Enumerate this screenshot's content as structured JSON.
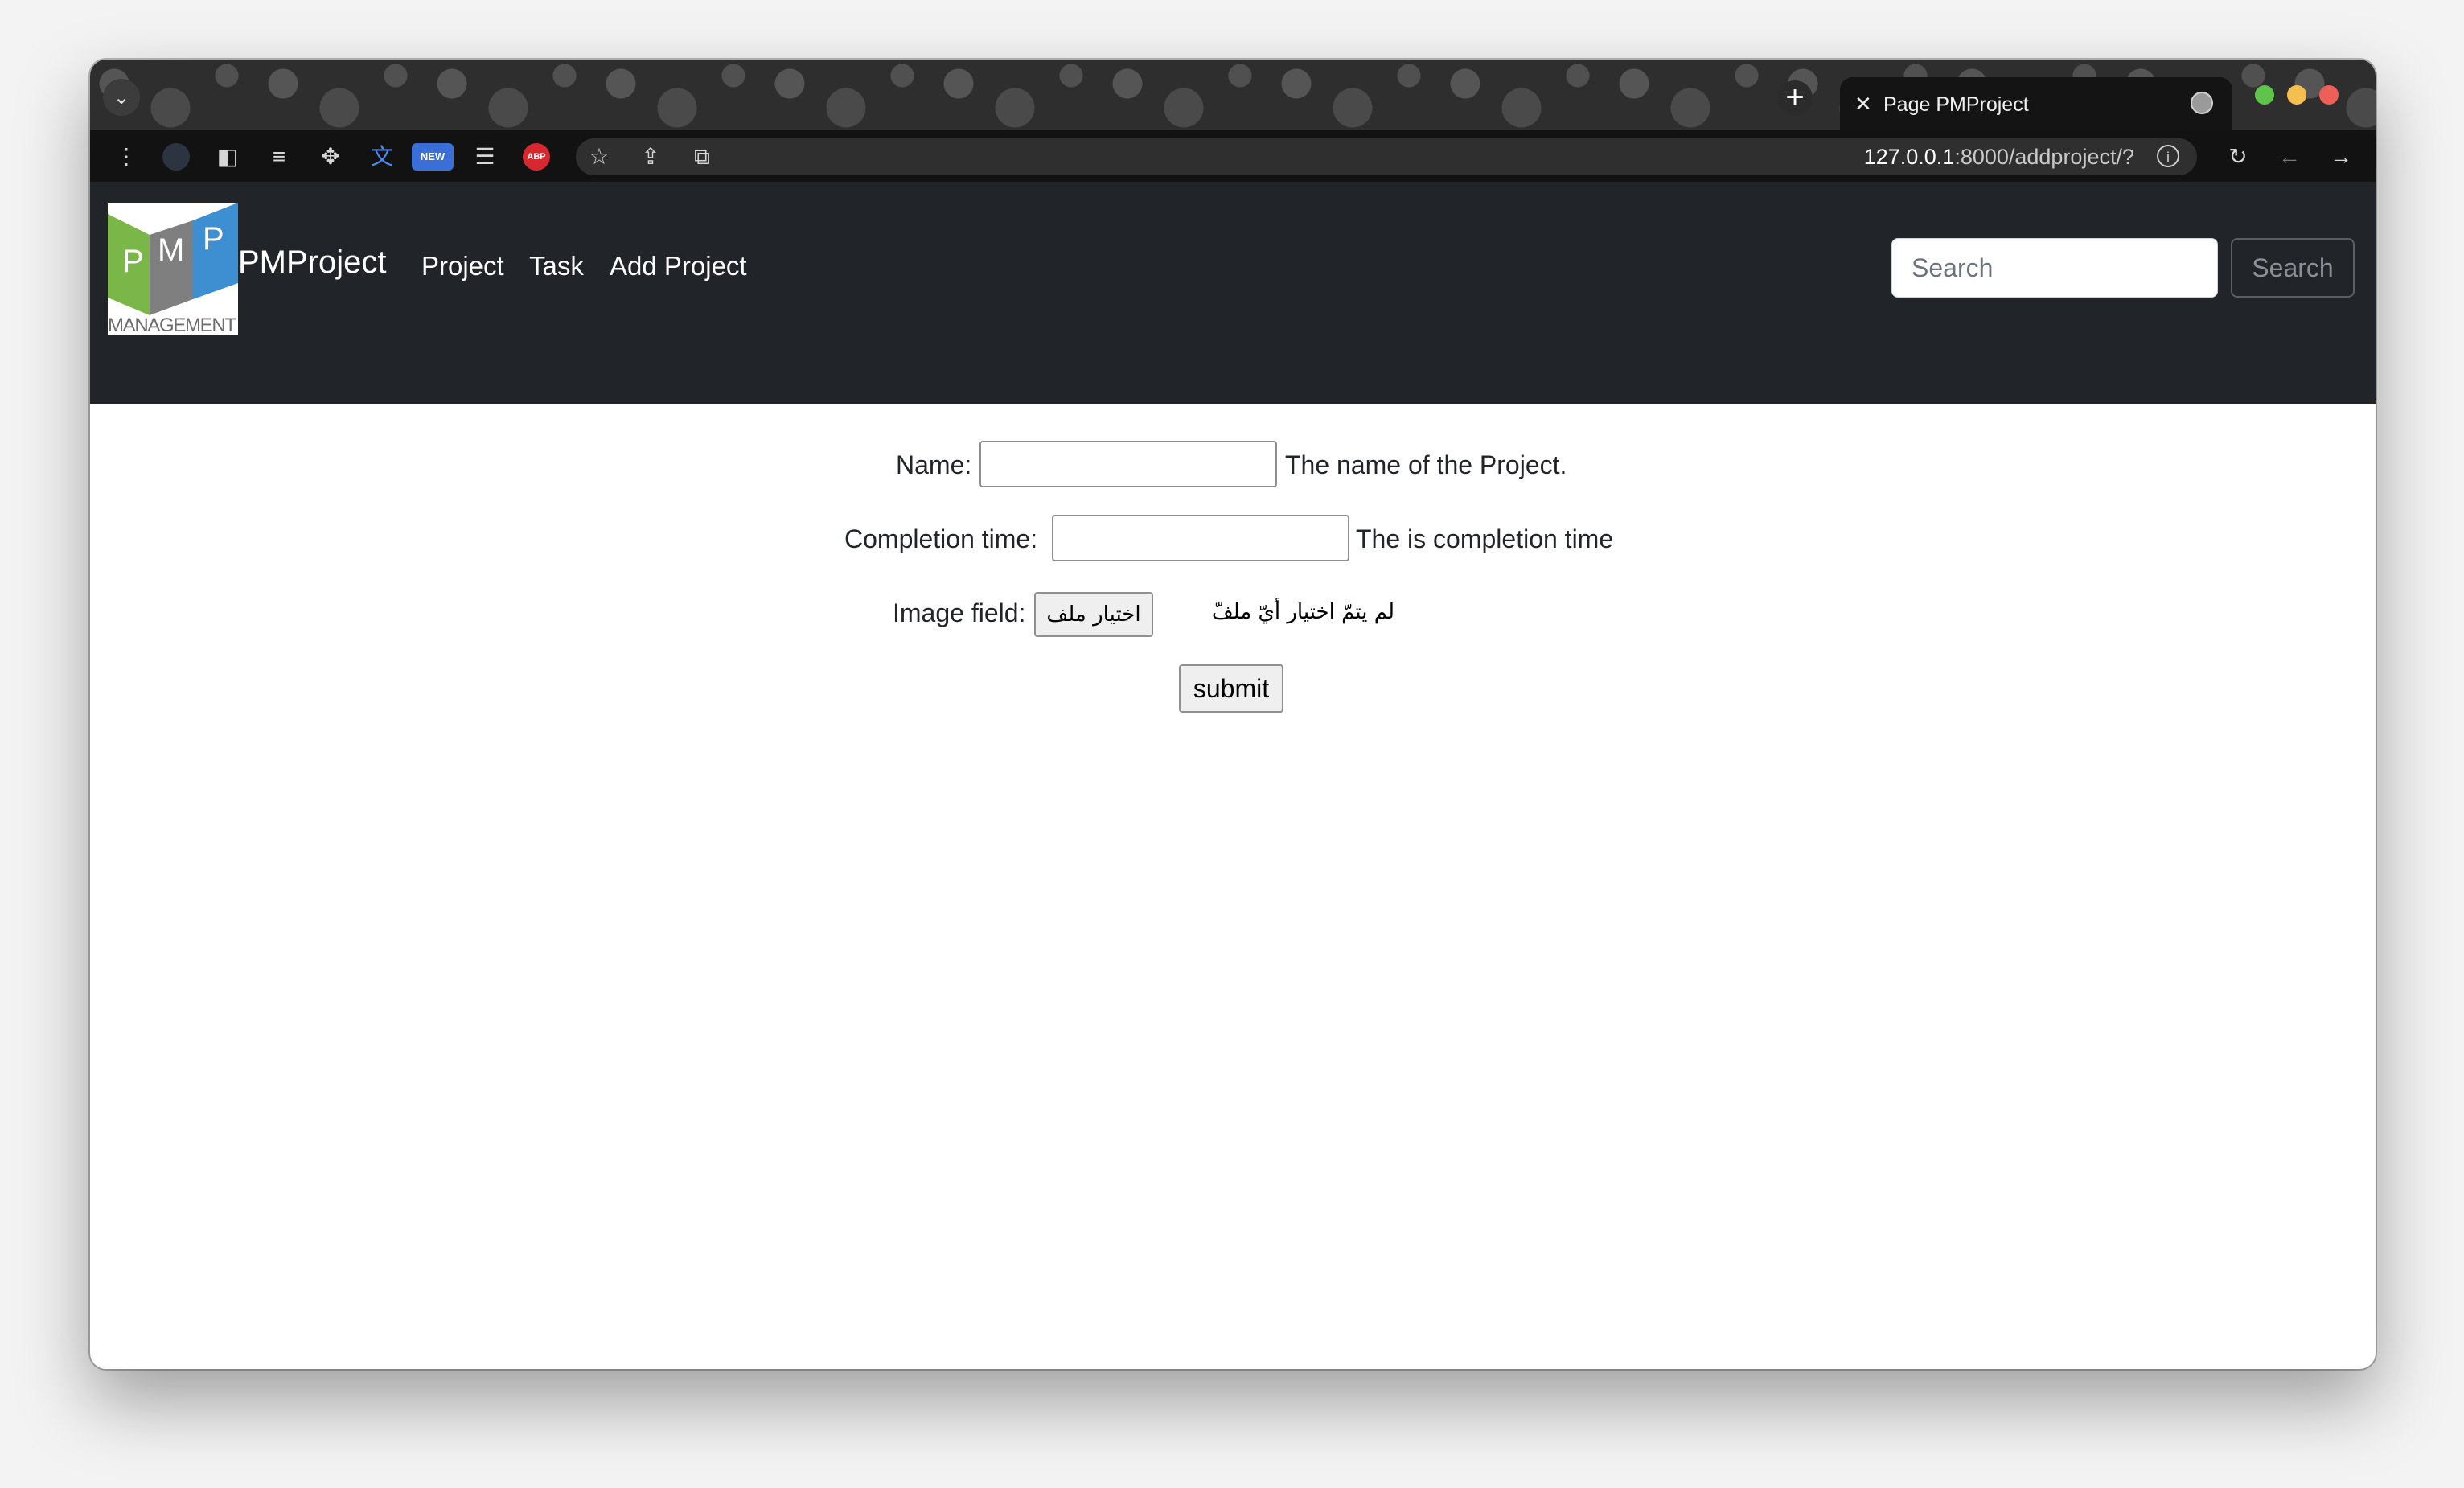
{
  "browser": {
    "tab_title": "Page PMProject",
    "url_host": "127.0.0.1",
    "url_rest": ":8000/addproject/?",
    "extension_new_badge": "NEW",
    "extension_abp_badge": "ABP"
  },
  "navbar": {
    "logo_letters": [
      "P",
      "M",
      "P"
    ],
    "logo_caption": "MANAGEMENT",
    "brand": "PMProject",
    "links": [
      "Project",
      "Task",
      "Add Project"
    ],
    "search": {
      "placeholder": "Search",
      "button_label": "Search"
    }
  },
  "form": {
    "name": {
      "label": "Name:",
      "value": "",
      "help": "The name of the Project."
    },
    "completion_time": {
      "label": "Completion time:",
      "value": "",
      "help": "The is completion time"
    },
    "image": {
      "label": "Image field:",
      "button_label": "اختيار ملف",
      "status": "لم يتمّ اختيار أيّ ملفّ"
    },
    "submit_label": "submit"
  },
  "colors": {
    "navbar_bg": "#212529",
    "toolbar_bg": "#121212",
    "logo_green": "#7ab648",
    "logo_gray": "#7f7f7f",
    "logo_blue": "#3d8fd1"
  }
}
